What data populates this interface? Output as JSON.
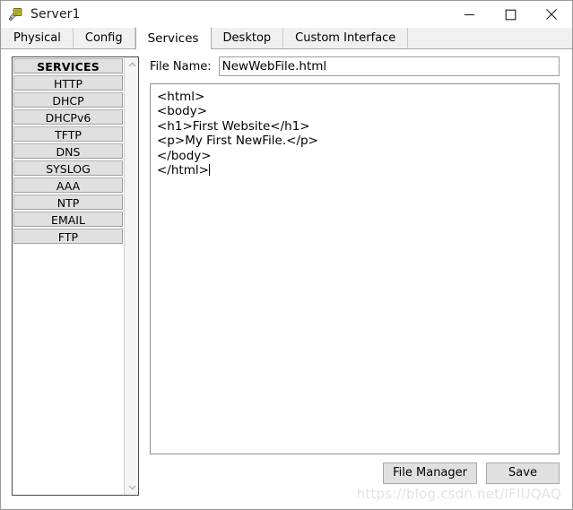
{
  "window": {
    "title": "Server1",
    "icon": "server-device-icon",
    "controls": {
      "minimize": "minimize-icon",
      "maximize": "maximize-icon",
      "close": "close-icon"
    }
  },
  "tabs": [
    {
      "label": "Physical",
      "active": false
    },
    {
      "label": "Config",
      "active": false
    },
    {
      "label": "Services",
      "active": true
    },
    {
      "label": "Desktop",
      "active": false
    },
    {
      "label": "Custom Interface",
      "active": false
    }
  ],
  "sidebar": {
    "header": "SERVICES",
    "items": [
      {
        "label": "HTTP"
      },
      {
        "label": "DHCP"
      },
      {
        "label": "DHCPv6"
      },
      {
        "label": "TFTP"
      },
      {
        "label": "DNS"
      },
      {
        "label": "SYSLOG"
      },
      {
        "label": "AAA"
      },
      {
        "label": "NTP"
      },
      {
        "label": "EMAIL"
      },
      {
        "label": "FTP"
      }
    ],
    "scrollbar": {
      "up_arrow": "chevron-up-icon",
      "down_arrow": "chevron-down-icon"
    }
  },
  "main": {
    "filename_label": "File Name:",
    "filename_value": "NewWebFile.html",
    "filename_placeholder": "",
    "code_value": "<html>\n<body>\n<h1>First Website</h1>\n<p>My First NewFile.</p>\n</body>\n</html>",
    "buttons": {
      "file_manager": "File Manager",
      "save": "Save"
    }
  },
  "watermark": "https://blog.csdn.net/IFIUQAQ",
  "colors": {
    "window_bg": "#ffffff",
    "tab_bar_bg": "#f0f0f0",
    "button_face": "#e0e0e0",
    "border": "#9a9a9a",
    "text": "#000000",
    "watermark": "#e3e3e7"
  }
}
